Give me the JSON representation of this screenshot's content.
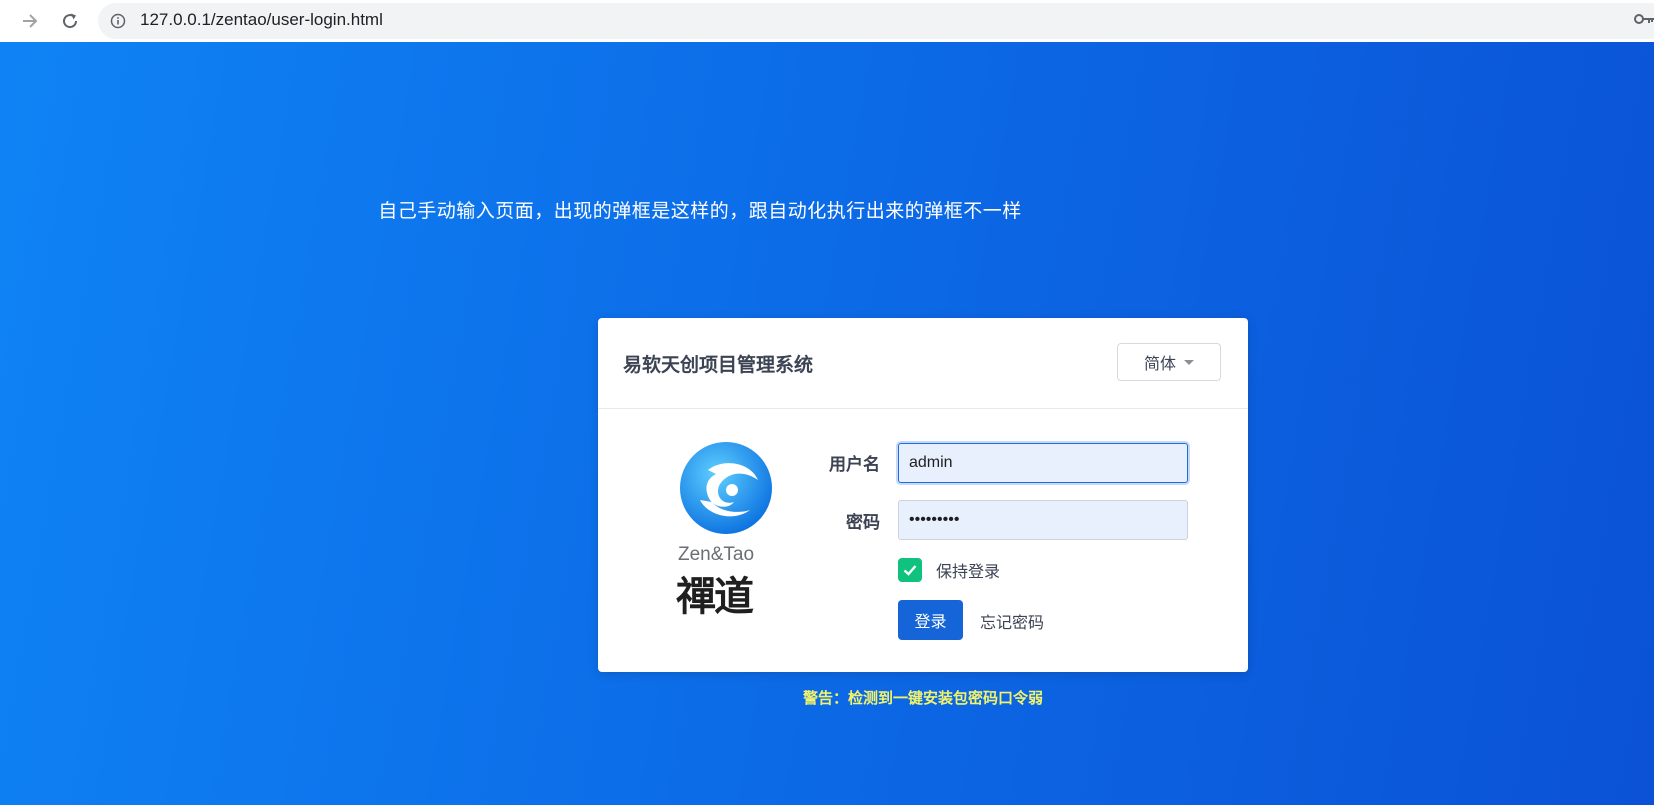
{
  "browser": {
    "url": "127.0.0.1/zentao/user-login.html"
  },
  "page": {
    "note": "自己手动输入页面，出现的弹框是这样的，跟自动化执行出来的弹框不一样",
    "warning": "警告：检测到一键安装包密码口令弱"
  },
  "login": {
    "title": "易软天创项目管理系统",
    "language": "简体",
    "logo": {
      "text_en": "Zen&Tao",
      "text_cn": "禪道"
    },
    "username_label": "用户名",
    "username_value": "admin",
    "password_label": "密码",
    "password_value": "*********",
    "remember_label": "保持登录",
    "remember_checked": true,
    "submit_label": "登录",
    "forgot_label": "忘记密码"
  },
  "colors": {
    "primary": "#1565d8",
    "background_start": "#0f83f5",
    "background_end": "#0b52d6",
    "checkbox": "#0fc27e",
    "warning": "#f1f36b"
  }
}
